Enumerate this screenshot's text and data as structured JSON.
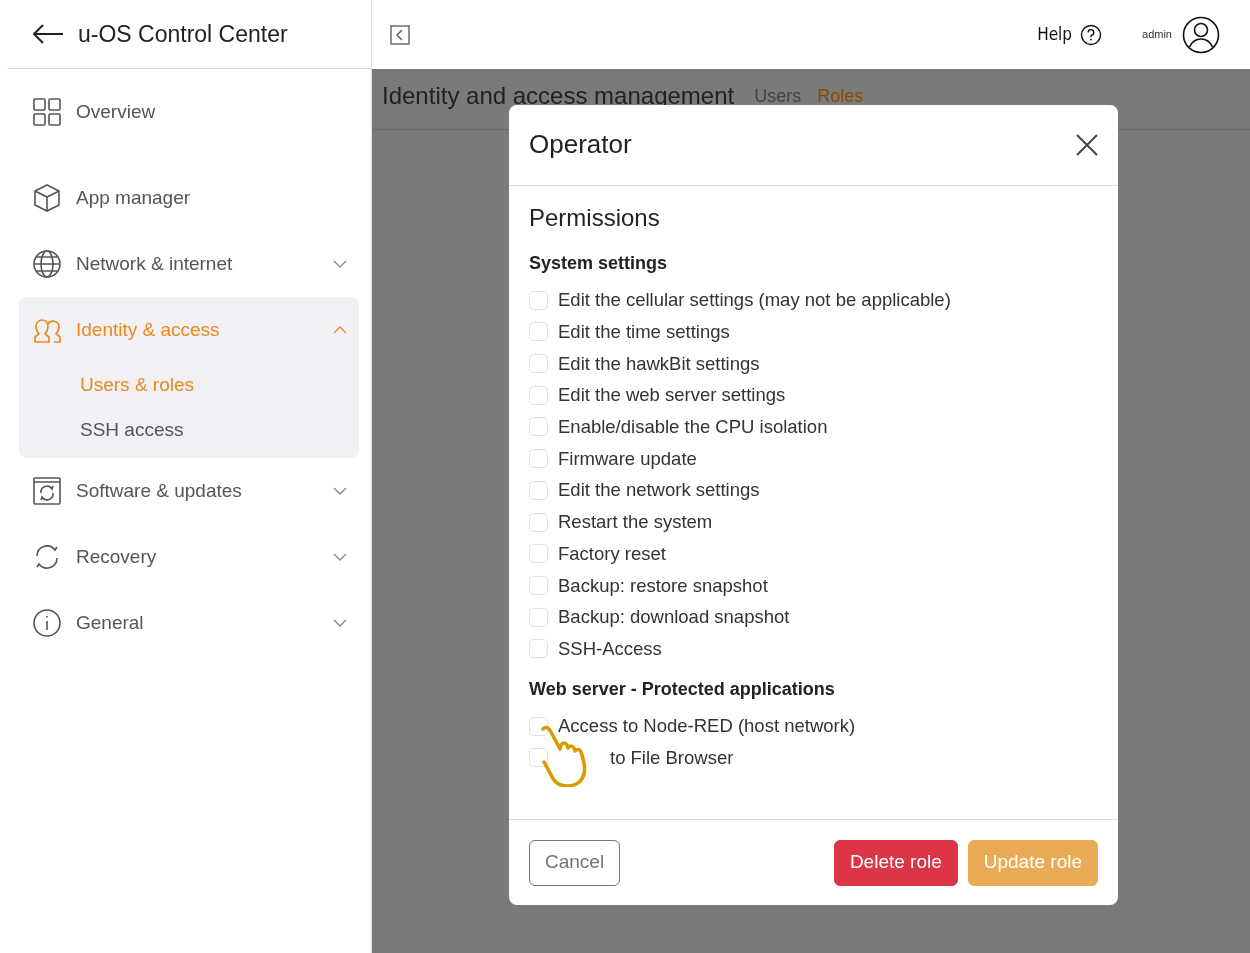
{
  "app": {
    "title": "u-OS Control Center"
  },
  "sidebar": {
    "items": [
      {
        "label": "Overview",
        "kind": "link",
        "selected": false
      },
      {
        "label": "App manager",
        "kind": "link",
        "selected": false
      },
      {
        "label": "Network & internet",
        "kind": "group",
        "selected": false,
        "expanded": false
      },
      {
        "label": "Identity & access",
        "kind": "group",
        "selected": true,
        "expanded": true,
        "children": [
          {
            "label": "Users & roles",
            "selected": true
          },
          {
            "label": "SSH access",
            "selected": false
          }
        ]
      },
      {
        "label": "Software & updates",
        "kind": "group",
        "selected": false,
        "expanded": false
      },
      {
        "label": "Recovery",
        "kind": "group",
        "selected": false,
        "expanded": false
      },
      {
        "label": "General",
        "kind": "group",
        "selected": false,
        "expanded": false
      }
    ]
  },
  "header": {
    "help": "Help",
    "user": "admin"
  },
  "page": {
    "title": "Identity and access management",
    "tabs": [
      {
        "label": "Users",
        "selected": false
      },
      {
        "label": "Roles",
        "selected": true
      }
    ]
  },
  "dialog": {
    "title": "Operator",
    "heading": "Permissions",
    "sections": [
      {
        "title": "System settings",
        "permissions": [
          {
            "label": "Edit the cellular settings (may not be applicable)",
            "checked": false
          },
          {
            "label": "Edit the time settings",
            "checked": false
          },
          {
            "label": "Edit the hawkBit settings",
            "checked": false
          },
          {
            "label": "Edit the web server settings",
            "checked": false
          },
          {
            "label": "Enable/disable the CPU isolation",
            "checked": false
          },
          {
            "label": "Firmware update",
            "checked": false
          },
          {
            "label": "Edit the network settings",
            "checked": false
          },
          {
            "label": "Restart the system",
            "checked": false
          },
          {
            "label": "Factory reset",
            "checked": false
          },
          {
            "label": "Backup: restore snapshot",
            "checked": false
          },
          {
            "label": "Backup: download snapshot",
            "checked": false
          },
          {
            "label": "SSH-Access",
            "checked": false
          }
        ]
      },
      {
        "title": "Web server - Protected applications",
        "permissions": [
          {
            "label": "Access to Node-RED (host network)",
            "checked": false
          },
          {
            "label": "to File Browser",
            "checked": false
          }
        ]
      }
    ],
    "buttons": [
      {
        "label": "Cancel",
        "kind": "secondary"
      },
      {
        "label": "Delete role",
        "kind": "danger"
      },
      {
        "label": "Update role",
        "kind": "primary"
      }
    ]
  }
}
